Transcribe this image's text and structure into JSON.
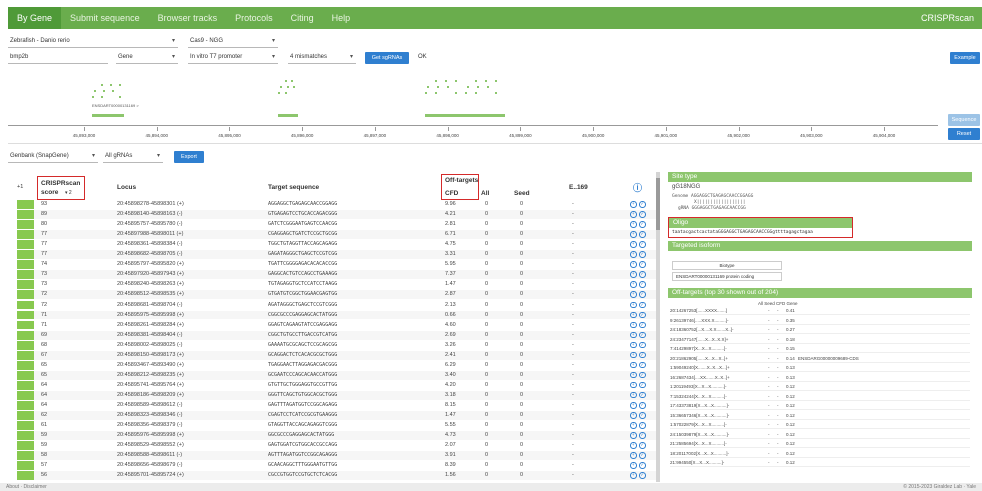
{
  "nav": {
    "items": [
      "By Gene",
      "Submit sequence",
      "Browser tracks",
      "Protocols",
      "Citing",
      "Help"
    ],
    "brand": "CRISPRscan"
  },
  "controls": {
    "species": "Zebrafish - Danio rerio",
    "enzyme": "Cas9 - NGG",
    "gene_value": "bmp2b",
    "gene_type": "Gene",
    "promoter": "In vitro T7 promoter",
    "mismatches": "4 mismatches",
    "get_sgrnas": "Get sgRNAs",
    "status": "OK",
    "example": "Example",
    "sequence": "Sequence",
    "reset": "Reset",
    "genbank": "Genbank (SnapGene)",
    "all_grnas": "All gRNAs",
    "export": "Export"
  },
  "browser": {
    "transcript_label": "ENSDART00000131169 >",
    "ticks": [
      "45,893,000",
      "45,894,000",
      "45,895,000",
      "45,896,000",
      "45,897,000",
      "45,898,000",
      "45,899,000",
      "45,900,000",
      "45,901,000",
      "45,902,000",
      "45,903,000",
      "45,904,000"
    ]
  },
  "table": {
    "headers": {
      "row_count": "+1",
      "score": "CRISPRscan",
      "score_sub": "score",
      "score_sort": "▾ 2",
      "locus": "Locus",
      "target": "Target sequence",
      "offtargets": "Off-targets",
      "cfd": "CFD",
      "all": "All",
      "seed": "Seed",
      "e169": "E..169",
      "info": "ⓘ"
    },
    "rows": [
      [
        "93",
        "20:45898278-45898301 (+)",
        "AGGAGGCTGAGAGCAACCGGAGG",
        "9.96",
        "0",
        "0",
        "-"
      ],
      [
        "89",
        "20:45898140-45898163 (-)",
        "GTGAGAGTCCTGCACCAGACGGG",
        "4.21",
        "0",
        "0",
        "-"
      ],
      [
        "80",
        "20:45895757-45895780 (-)",
        "GATCTCGGGAATGAGTCCAACGG",
        "2.81",
        "0",
        "0",
        "-"
      ],
      [
        "77",
        "20:45897988-45898011 (+)",
        "CGAGGAGCTGATCTCCGCTGCGG",
        "6.71",
        "0",
        "0",
        "-"
      ],
      [
        "77",
        "20:45898361-45898384 (-)",
        "TGGCTGTAGGTTACCAGCAGAGG",
        "4.75",
        "0",
        "0",
        "-"
      ],
      [
        "77",
        "20:45898682-45898705 (-)",
        "GAGATAGGGCTGAGCTCCGTCGG",
        "3.31",
        "0",
        "0",
        "-"
      ],
      [
        "74",
        "20:45895797-45895820 (+)",
        "TGATTCGGGGAGACACACACCGG",
        "5.95",
        "0",
        "0",
        "-"
      ],
      [
        "73",
        "20:45897920-45897943 (+)",
        "GAGGCACTGTCCAGCCTGAAAGG",
        "7.37",
        "0",
        "0",
        "-"
      ],
      [
        "73",
        "20:45898240-45898263 (+)",
        "TGTAGAGGTGCTCCATCCTAAGG",
        "1.47",
        "0",
        "0",
        "-"
      ],
      [
        "72",
        "20:45898512-45898535 (+)",
        "GTGATGTCGGCTGGAACGAGTGG",
        "2.87",
        "0",
        "0",
        "-"
      ],
      [
        "72",
        "20:45898681-45898704 (-)",
        "AGATAGGGCTGAGCTCCGTCGGG",
        "2.13",
        "0",
        "0",
        "-"
      ],
      [
        "71",
        "20:45895975-45895998 (+)",
        "CGGCGCCCGAGGAGCACTATGGG",
        "0.66",
        "0",
        "0",
        "-"
      ],
      [
        "71",
        "20:45898261-45898284 (+)",
        "GGAGTCAGAAGTATCCGAGGAGG",
        "4.60",
        "0",
        "0",
        "-"
      ],
      [
        "69",
        "20:45898381-45898404 (-)",
        "CGGCTGTGCCTTGACCGTCATGG",
        "2.69",
        "0",
        "0",
        "-"
      ],
      [
        "68",
        "20:45898002-45898025 (-)",
        "GAAAATGCGCAGCTCCGCAGCGG",
        "3.26",
        "0",
        "0",
        "-"
      ],
      [
        "67",
        "20:45898150-45898173 (+)",
        "GCAGGACTCTCACACGCGCTGGG",
        "2.41",
        "0",
        "0",
        "-"
      ],
      [
        "65",
        "20:45893467-45893490 (+)",
        "TGAGGAACTTAGGAGACGACGGG",
        "6.29",
        "0",
        "0",
        "-"
      ],
      [
        "65",
        "20:45898212-45898235 (+)",
        "GCGAATCCCAGCACAACCATGGG",
        "3.40",
        "0",
        "0",
        "-"
      ],
      [
        "64",
        "20:45895741-45895764 (+)",
        "GTGTTGCTGGGAGGTGCCGTTGG",
        "4.20",
        "0",
        "0",
        "-"
      ],
      [
        "64",
        "20:45898186-45898209 (+)",
        "GGGTTCAGCTGTGGCACGCTGGG",
        "3.18",
        "0",
        "0",
        "-"
      ],
      [
        "64",
        "20:45898589-45898612 (-)",
        "GAGTTTAGATGGTCCGGCAGAGG",
        "8.15",
        "0",
        "0",
        "-"
      ],
      [
        "62",
        "20:45898323-45898346 (-)",
        "CGAGTCCTCATCCGCGTGAAGGG",
        "1.47",
        "0",
        "0",
        "-"
      ],
      [
        "61",
        "20:45898356-45898379 (-)",
        "GTAGGTTACCAGCAGAGGTCGGG",
        "5.55",
        "0",
        "0",
        "-"
      ],
      [
        "59",
        "20:45895976-45895998 (+)",
        "GGCGCCCGAGGAGCACTATGGG",
        "4.73",
        "0",
        "0",
        "-"
      ],
      [
        "59",
        "20:45898529-45898552 (+)",
        "GAGTGGATCGTGGCACCGCCAGG",
        "2.07",
        "0",
        "0",
        "-"
      ],
      [
        "58",
        "20:45898588-45898611 (-)",
        "AGTTTAGATGGTCCGGCAGAGGG",
        "3.91",
        "0",
        "0",
        "-"
      ],
      [
        "57",
        "20:45898656-45898679 (-)",
        "GCAACAGGCTTTGGGAATGTTGG",
        "8.39",
        "0",
        "0",
        "-"
      ],
      [
        "56",
        "20:45895701-45895724 (+)",
        "CGCCGTGGTCCGTGCTCTCACGG",
        "1.56",
        "0",
        "0",
        "-"
      ]
    ]
  },
  "side": {
    "site_type_h": "Site type",
    "site_type": "gG18NGG",
    "genome_label": "Genome",
    "grna_label": "gRNA",
    "genome_seq": "AGGAGGCTGAGAGCAACCGGAGG",
    "match_line": "X||||||||||||||||||",
    "grna_seq": "GGGAGGCTGAGAGCAACCGG",
    "oligo_h": "Oligo",
    "oligo": "taatacgactcactataGGGAGGCTGAGAGCAACCGGgttttagagctagaa",
    "iso_h": "Targeted isoform",
    "biotype_h": "Biotype",
    "biotype": "ENSDART00000131169 protein coding",
    "ot_h": "Off-targets (top 30 shown out of 204)",
    "ot_cols": "All  Seed  CFD  Gene",
    "ot_rows": [
      [
        "20:14267253[......XXXX.......]",
        "-",
        "-",
        "0.41",
        ""
      ],
      [
        "9:26139746[.....XXX.X.........]-",
        "-",
        "-",
        "0.35",
        ""
      ],
      [
        "24:18360752[...X....X.X.......X..]-",
        "-",
        "-",
        "0.27",
        ""
      ],
      [
        "24:23477147[......X...X..X.X]+",
        "-",
        "-",
        "0.18",
        ""
      ],
      [
        "7:41429897[X...X...X..........]-",
        "-",
        "-",
        "0.15",
        ""
      ],
      [
        "20:21862905[......X...X...X..]+",
        "-",
        "-",
        "0.14",
        "ENSDARG00000009689-CDS"
      ],
      [
        "1:59049240[X.......X..X...X...]+",
        "-",
        "-",
        "0.13",
        ""
      ],
      [
        "16:2687434[....XX.......X..X..]+",
        "-",
        "-",
        "0.13",
        ""
      ],
      [
        "1:20119493[X...X...X..........]-",
        "-",
        "-",
        "0.12",
        ""
      ],
      [
        "7:15324244[X...X...X..........]-",
        "-",
        "-",
        "0.12",
        ""
      ],
      [
        "17:43373819[X...X...X..........]-",
        "-",
        "-",
        "0.12",
        ""
      ],
      [
        "15:36657346[X...X...X..........]-",
        "-",
        "-",
        "0.12",
        ""
      ],
      [
        "1:57022879[X...X...X..........]-",
        "-",
        "-",
        "0.12",
        ""
      ],
      [
        "24:15039879[X...X...X..........]-",
        "-",
        "-",
        "0.12",
        ""
      ],
      [
        "21:2585694[X...X...X..........]-",
        "-",
        "-",
        "0.12",
        ""
      ],
      [
        "18:20117002[X...X...X..........]-",
        "-",
        "-",
        "0.12",
        ""
      ],
      [
        "21:994550[X...X...X..........]-",
        "-",
        "-",
        "0.12",
        ""
      ]
    ]
  },
  "footer": {
    "left": "About · Disclaimer",
    "right": "© 2015-2023 Giraldez Lab · Yale"
  }
}
